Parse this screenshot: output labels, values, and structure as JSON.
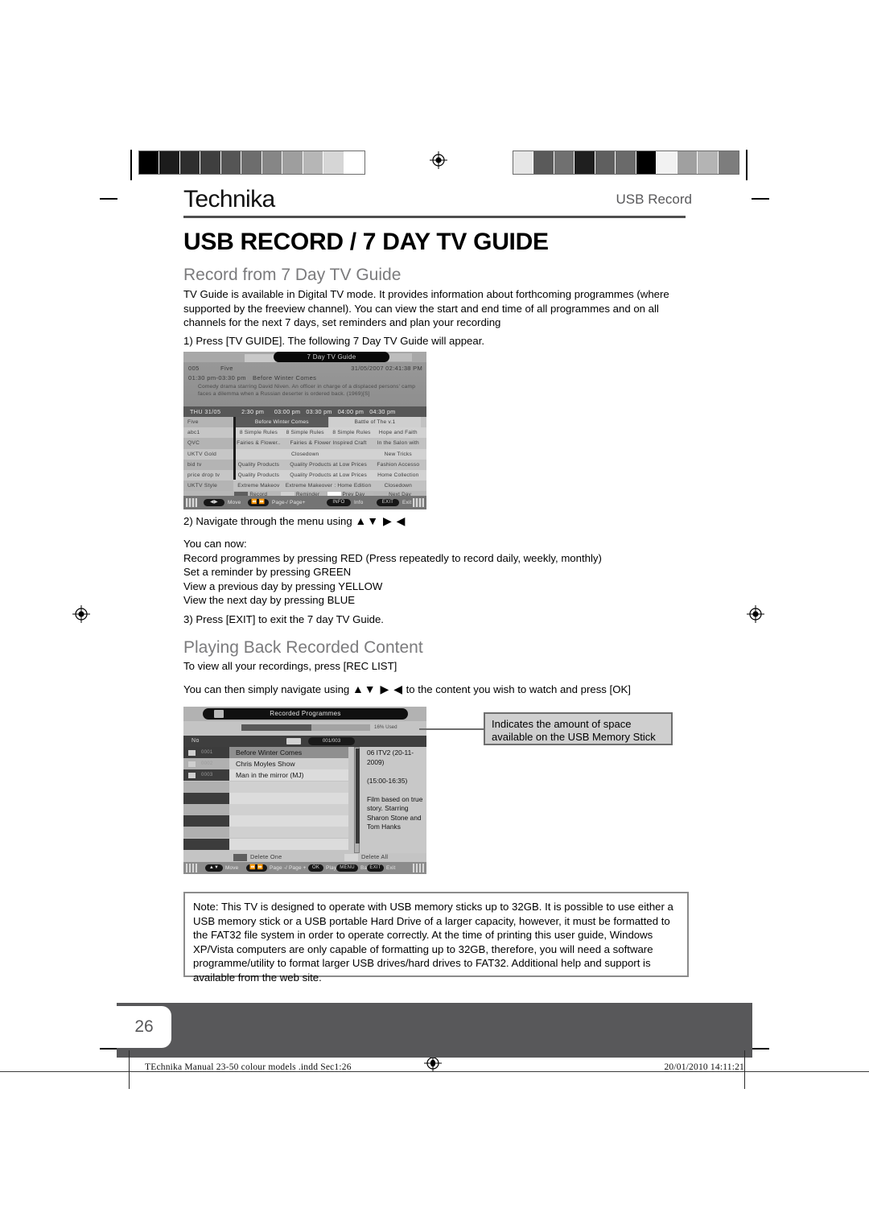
{
  "header": {
    "brand": "Technika",
    "section": "USB Record",
    "title": "USB RECORD / 7 DAY TV GUIDE"
  },
  "sections": {
    "heading1": "Record from 7 Day TV Guide",
    "para1": "TV Guide is available in Digital TV mode. It provides information about forthcoming programmes (where supported by the freeview channel). You can view the start and end time of all programmes and on all channels for the next 7 days, set reminders and plan your recording",
    "step1": "1) Press [TV GUIDE]. The following 7 Day TV Guide will appear.",
    "step2": "2) Navigate through the menu using",
    "step2_arrows": "▲▼ ▶ ◀",
    "you_can_now": "You can now:",
    "bullet1": "Record programmes by pressing RED (Press repeatedly to record daily, weekly, monthly)",
    "bullet2": "Set a reminder by pressing GREEN",
    "bullet3": "View a previous day by pressing YELLOW",
    "bullet4": "View the next day by pressing BLUE",
    "step3": "3) Press [EXIT] to exit the 7 day TV Guide.",
    "heading2": "Playing Back Recorded Content",
    "para2": "To view all your recordings, press [REC LIST]",
    "para3_pre": "You can then simply navigate using",
    "para3_arrows": "▲▼ ▶ ◀",
    "para3_post": "to the content you wish to watch and press [OK]"
  },
  "tv_guide": {
    "window_title": "7 Day TV Guide",
    "channel_number": "005",
    "channel_name": "Five",
    "datetime": "31/05/2007 02:41:38 PM",
    "programme_time": "01:30 pm-03:30 pm",
    "programme_title": "Before Winter Comes",
    "description": "Comedy drama starring David Niven. An officer in charge of a displaced persons' camp faces a dilemma when a Russian deserter is ordered back. (1969)[S]",
    "day_label": "THU  31/05",
    "time_slots": [
      "2:30 pm",
      "03:00 pm",
      "03:30 pm",
      "04:00 pm",
      "04:30 pm"
    ],
    "rows": [
      {
        "channel": "Five",
        "cells": [
          {
            "text": "Before Winter Comes",
            "span": 2,
            "state": "selected"
          },
          {
            "text": "Battle of The v.1",
            "span": 2,
            "state": "light"
          }
        ]
      },
      {
        "channel": "abc1",
        "cells": [
          {
            "text": "8 Simple Rules",
            "span": 1,
            "state": "normal"
          },
          {
            "text": "8 Simple Rules",
            "span": 1,
            "state": "normal"
          },
          {
            "text": "8 Simple Rules",
            "span": 1,
            "state": "normal"
          },
          {
            "text": "Hope and Faith",
            "span": 1,
            "state": "normal"
          }
        ]
      },
      {
        "channel": "QVC",
        "cells": [
          {
            "text": "Fairies & Flower..",
            "span": 1,
            "state": "normal"
          },
          {
            "text": "Fairies & Flower Inspired Craft",
            "span": 2,
            "state": "normal"
          },
          {
            "text": "In the Salon with",
            "span": 1,
            "state": "normal"
          }
        ]
      },
      {
        "channel": "UKTV Gold",
        "cells": [
          {
            "text": "Closedown",
            "span": 3,
            "state": "normal"
          },
          {
            "text": "New Tricks",
            "span": 1,
            "state": "normal"
          }
        ]
      },
      {
        "channel": "bid tv",
        "cells": [
          {
            "text": "Quality Products",
            "span": 1,
            "state": "normal"
          },
          {
            "text": "Quality Products at Low Prices",
            "span": 2,
            "state": "normal"
          },
          {
            "text": "Fashion Accesso",
            "span": 1,
            "state": "normal"
          }
        ]
      },
      {
        "channel": "price drop tv",
        "cells": [
          {
            "text": "Quality Products",
            "span": 1,
            "state": "normal"
          },
          {
            "text": "Quality Products at Low Prices",
            "span": 2,
            "state": "normal"
          },
          {
            "text": "Home Collection",
            "span": 1,
            "state": "normal"
          }
        ]
      },
      {
        "channel": "UKTV Style",
        "cells": [
          {
            "text": "Extreme Makeov",
            "span": 1,
            "state": "normal"
          },
          {
            "text": "Extreme Makeover : Home  Edition",
            "span": 2,
            "state": "normal"
          },
          {
            "text": "Closedown",
            "span": 1,
            "state": "normal"
          }
        ]
      }
    ],
    "legend": [
      {
        "label": "Record",
        "color": "#5e5e5e"
      },
      {
        "label": "Reminder",
        "color": "#d0d0d0"
      },
      {
        "label": "Prev Day",
        "color": "#ffffff"
      },
      {
        "label": "Next Day",
        "color": "#b6b6b6"
      }
    ],
    "footer_buttons": [
      {
        "key": "◀▶",
        "label": "Move"
      },
      {
        "key": "⏪ ⏩",
        "label": "Page-/ Page+"
      },
      {
        "key": "INFO",
        "label": "Info"
      },
      {
        "key": "EXIT",
        "label": "Exit"
      }
    ]
  },
  "rec_list": {
    "window_title": "Recorded Programmes",
    "used_label": "16% Used",
    "used_percent": 16,
    "column_header": "No",
    "page_indicator": "001/003",
    "items": [
      {
        "num": "0001",
        "name": "Before  Winter  Comes",
        "state": "selected"
      },
      {
        "num": "0002",
        "name": "Chris Moyles Show",
        "state": "normal"
      },
      {
        "num": "0003",
        "name": "Man in the mirror (MJ)",
        "state": "normal"
      }
    ],
    "detail": [
      "06 ITV2 (20-11-2009)",
      "",
      "(15:00-16:35)",
      "",
      "Film based on true",
      "story. Starring",
      "Sharon Stone and",
      "Tom Hanks"
    ],
    "legend": [
      {
        "label": "Delete One",
        "color": "#5e5e5e"
      },
      {
        "label": "Delete All",
        "color": "#d6d6d6"
      }
    ],
    "footer_buttons": [
      {
        "key": "▲▼",
        "label": "Move"
      },
      {
        "key": "⏪ ⏩",
        "label": "Page -/ Page +"
      },
      {
        "key": "OK",
        "label": "Play"
      },
      {
        "key": "MENU",
        "label": "Back"
      },
      {
        "key": "EXIT",
        "label": "Exit"
      }
    ]
  },
  "callout": {
    "line1": "Indicates the amount of space",
    "line2": "available on the USB Memory Stick"
  },
  "note": {
    "text": "Note: This TV is designed to operate with USB memory sticks up to 32GB. It is possible to use either a USB memory stick or a USB portable Hard Drive of a larger capacity, however, it must be formatted to the FAT32 file system in order to operate correctly. At the time of printing this user guide, Windows XP/Vista computers are only capable of formatting up to 32GB, therefore, you will need a software programme/utility to format larger USB drives/hard drives to FAT32. Additional help and support is available from the web site."
  },
  "page": {
    "number": "26"
  },
  "print_footer": {
    "left": "TEchnika Manual 23-50 colour models .indd   Sec1:26",
    "right": "20/01/2010   14:11:21"
  },
  "calibration": {
    "left_swatches": [
      "#000000",
      "#1c1c1c",
      "#2e2e2e",
      "#3f3f3f",
      "#555555",
      "#6d6d6d",
      "#868686",
      "#9e9e9e",
      "#b6b6b6",
      "#d6d6d6",
      "#ffffff"
    ],
    "right_swatches": [
      "#e6e6e6",
      "#5a5a5a",
      "#707070",
      "#1f1f1f",
      "#5f5f5f",
      "#6a6a6a",
      "#000000",
      "#f2f2f2",
      "#a0a0a0",
      "#b4b4b4",
      "#7d7d7d"
    ]
  }
}
